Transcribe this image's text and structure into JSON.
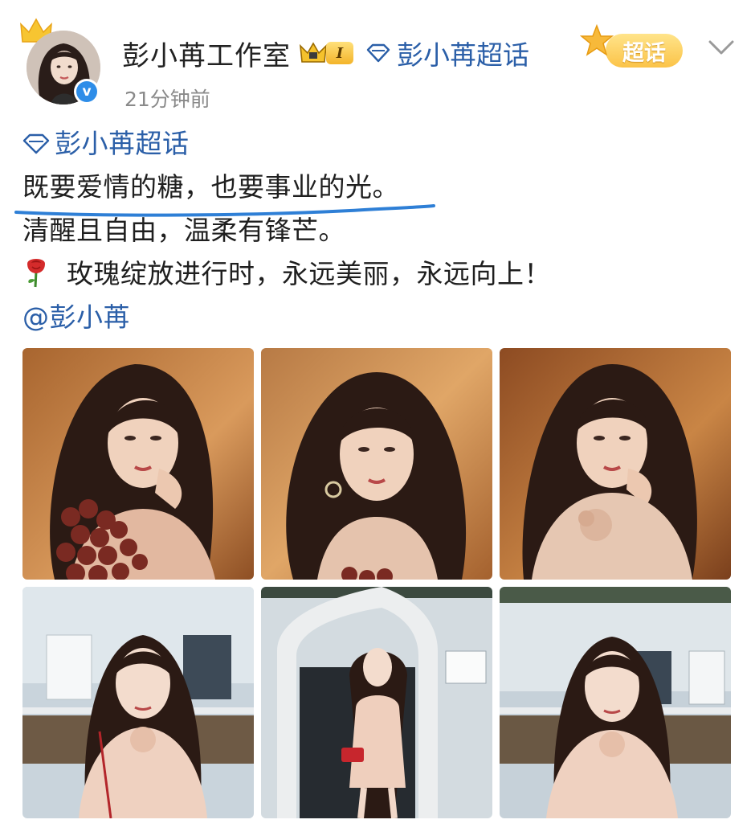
{
  "post": {
    "author": {
      "name": "彭小苒工作室",
      "vip_level": "I",
      "verified": true,
      "avatar": "avatar-photo"
    },
    "topic_tag": "彭小苒超话",
    "timestamp": "21分钟前",
    "chaohua_button": "超话",
    "body": {
      "topic": "彭小苒超话",
      "lines": [
        "既要爱情的糖，也要事业的光。",
        "清醒且自由，温柔有锋芒。",
        "玫瑰绽放进行时，永远美丽，永远向上！"
      ],
      "mention": "@彭小苒"
    },
    "photos": [
      {
        "scene": "warm-studio-roses"
      },
      {
        "scene": "warm-studio-portrait"
      },
      {
        "scene": "warm-studio-ruffle"
      },
      {
        "scene": "outdoor-house-left"
      },
      {
        "scene": "outdoor-arch-fullbody"
      },
      {
        "scene": "outdoor-house-right"
      }
    ]
  },
  "colors": {
    "link_blue": "#2b5fa8",
    "highlight_underline": "#2e7fd6",
    "timestamp_gray": "#8a8a8a",
    "chaohua_yellow": "#fbc348"
  },
  "icons": [
    "crown-icon",
    "vip-crown-icon",
    "diamond-icon",
    "star-icon",
    "chevron-down-icon",
    "rose-icon",
    "verified-icon"
  ]
}
